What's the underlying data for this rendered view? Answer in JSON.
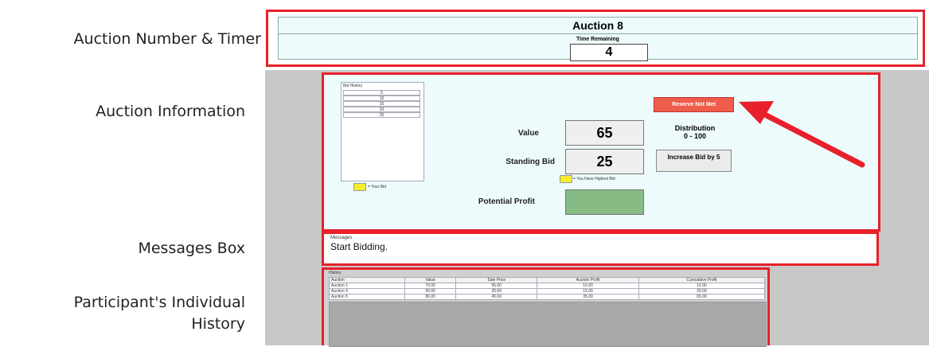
{
  "side_labels": {
    "auction_number_timer": "Auction Number & Timer",
    "auction_information": "Auction Information",
    "messages_box": "Messages Box",
    "history_line1": "Participant's Individual",
    "history_line2": "History"
  },
  "header": {
    "auction_title": "Auction 8",
    "time_remaining_label": "Time Remaining",
    "time_remaining_value": "4"
  },
  "auction_info": {
    "bid_history_title": "Bid History",
    "bid_history": [
      "5",
      "10",
      "15",
      "20",
      "25"
    ],
    "your_bid_legend": "= Your Bid",
    "value_label": "Value",
    "value": "65",
    "standing_bid_label": "Standing Bid",
    "standing_bid": "25",
    "highest_bid_legend": "= You Have Highest Bid",
    "potential_profit_label": "Potential Profit",
    "reserve_status": "Reserve Not Met",
    "distribution_label": "Distribution",
    "distribution_range": "0 - 100",
    "increase_bid_label": "Increase Bid by 5"
  },
  "messages": {
    "title": "Messages",
    "text": "Start Bidding."
  },
  "history": {
    "title": "History",
    "columns": [
      "Auction",
      "Value",
      "Sale Price",
      "Auction Profit",
      "Cumulative Profit"
    ],
    "rows": [
      [
        "Auction 1",
        "70.00",
        "55.00",
        "10.00",
        "10.00"
      ],
      [
        "Auction 4",
        "90.00",
        "25.00",
        "15.00",
        "30.00"
      ],
      [
        "Auction 5",
        "80.00",
        "45.00",
        "35.00",
        "65.00"
      ]
    ]
  },
  "colors": {
    "highlight_border": "#e8202a",
    "panel_bg": "#eefbfd",
    "reserve_button": "#ee5c4a",
    "profit_box": "#86bb86",
    "legend_yellow": "#f4ee2c"
  }
}
